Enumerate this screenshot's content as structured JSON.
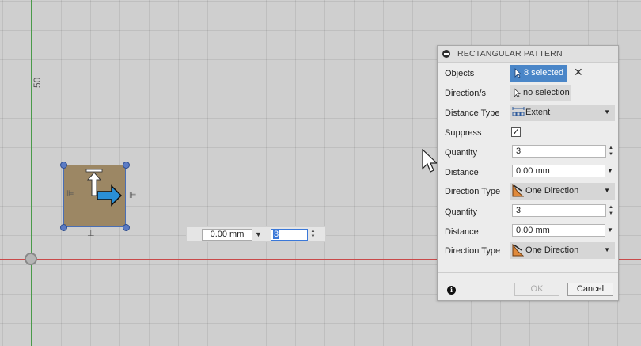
{
  "canvas": {
    "ruler_label": "50",
    "float_input": {
      "distance": "0.00 mm",
      "quantity": "3"
    }
  },
  "panel": {
    "title": "RECTANGULAR PATTERN",
    "rows": {
      "objects": {
        "label": "Objects",
        "value": "8 selected"
      },
      "directions": {
        "label": "Direction/s",
        "value": "no selection"
      },
      "distance_type": {
        "label": "Distance Type",
        "value": "Extent"
      },
      "suppress": {
        "label": "Suppress",
        "checked": true
      },
      "quantity1": {
        "label": "Quantity",
        "value": "3"
      },
      "distance1": {
        "label": "Distance",
        "value": "0.00 mm"
      },
      "direction_type1": {
        "label": "Direction Type",
        "value": "One Direction"
      },
      "quantity2": {
        "label": "Quantity",
        "value": "3"
      },
      "distance2": {
        "label": "Distance",
        "value": "0.00 mm"
      },
      "direction_type2": {
        "label": "Direction Type",
        "value": "One Direction"
      }
    },
    "buttons": {
      "ok": "OK",
      "cancel": "Cancel"
    }
  },
  "colors": {
    "selected_blue": "#4a86c8",
    "axis_green": "#4a9a4a",
    "axis_red": "#c94a4a",
    "sketch_fill": "#9c8764"
  }
}
